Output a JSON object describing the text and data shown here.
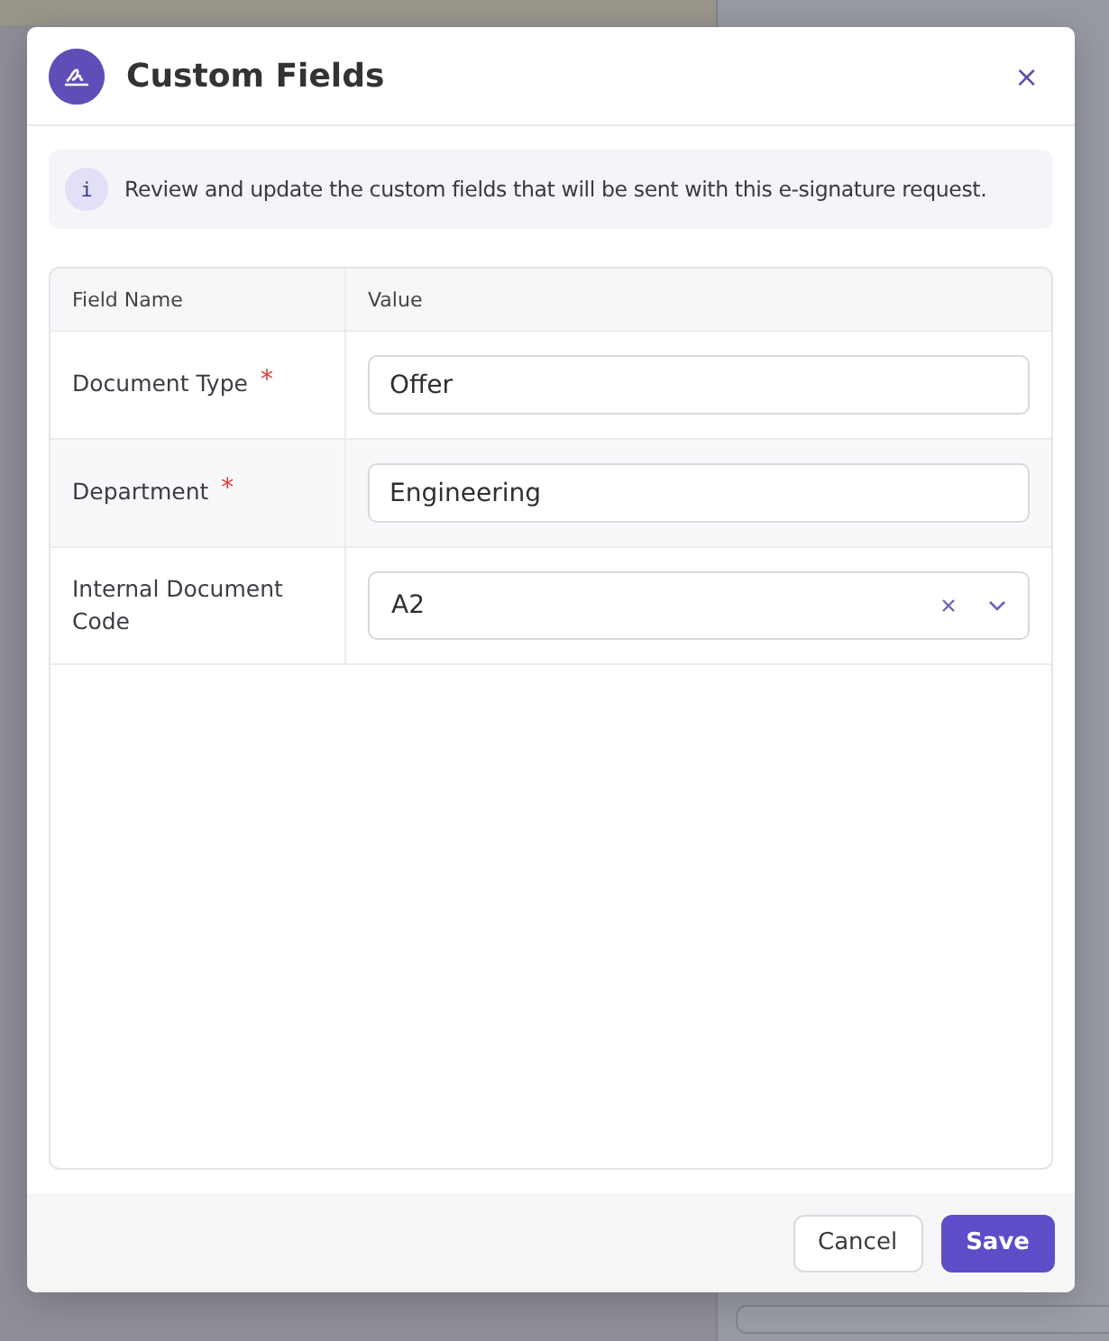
{
  "dialog": {
    "title": "Custom Fields",
    "close": "×",
    "info_icon": "i",
    "info": "Review and update the custom fields that will be sent with this e-signature request.",
    "columns": [
      "Field Name",
      "Value"
    ],
    "required_mark": "*",
    "fields": [
      {
        "label": "Document Type",
        "required": true,
        "kind": "text",
        "value": "Offer",
        "hovered": false
      },
      {
        "label": "Department",
        "required": true,
        "kind": "text",
        "value": "Engineering",
        "hovered": true
      },
      {
        "label": "Internal Document Code",
        "required": false,
        "kind": "select",
        "value": "A2",
        "hovered": false
      }
    ],
    "buttons": [
      {
        "label": "Cancel",
        "kind": "secondary"
      },
      {
        "label": "Save",
        "kind": "primary"
      }
    ]
  }
}
